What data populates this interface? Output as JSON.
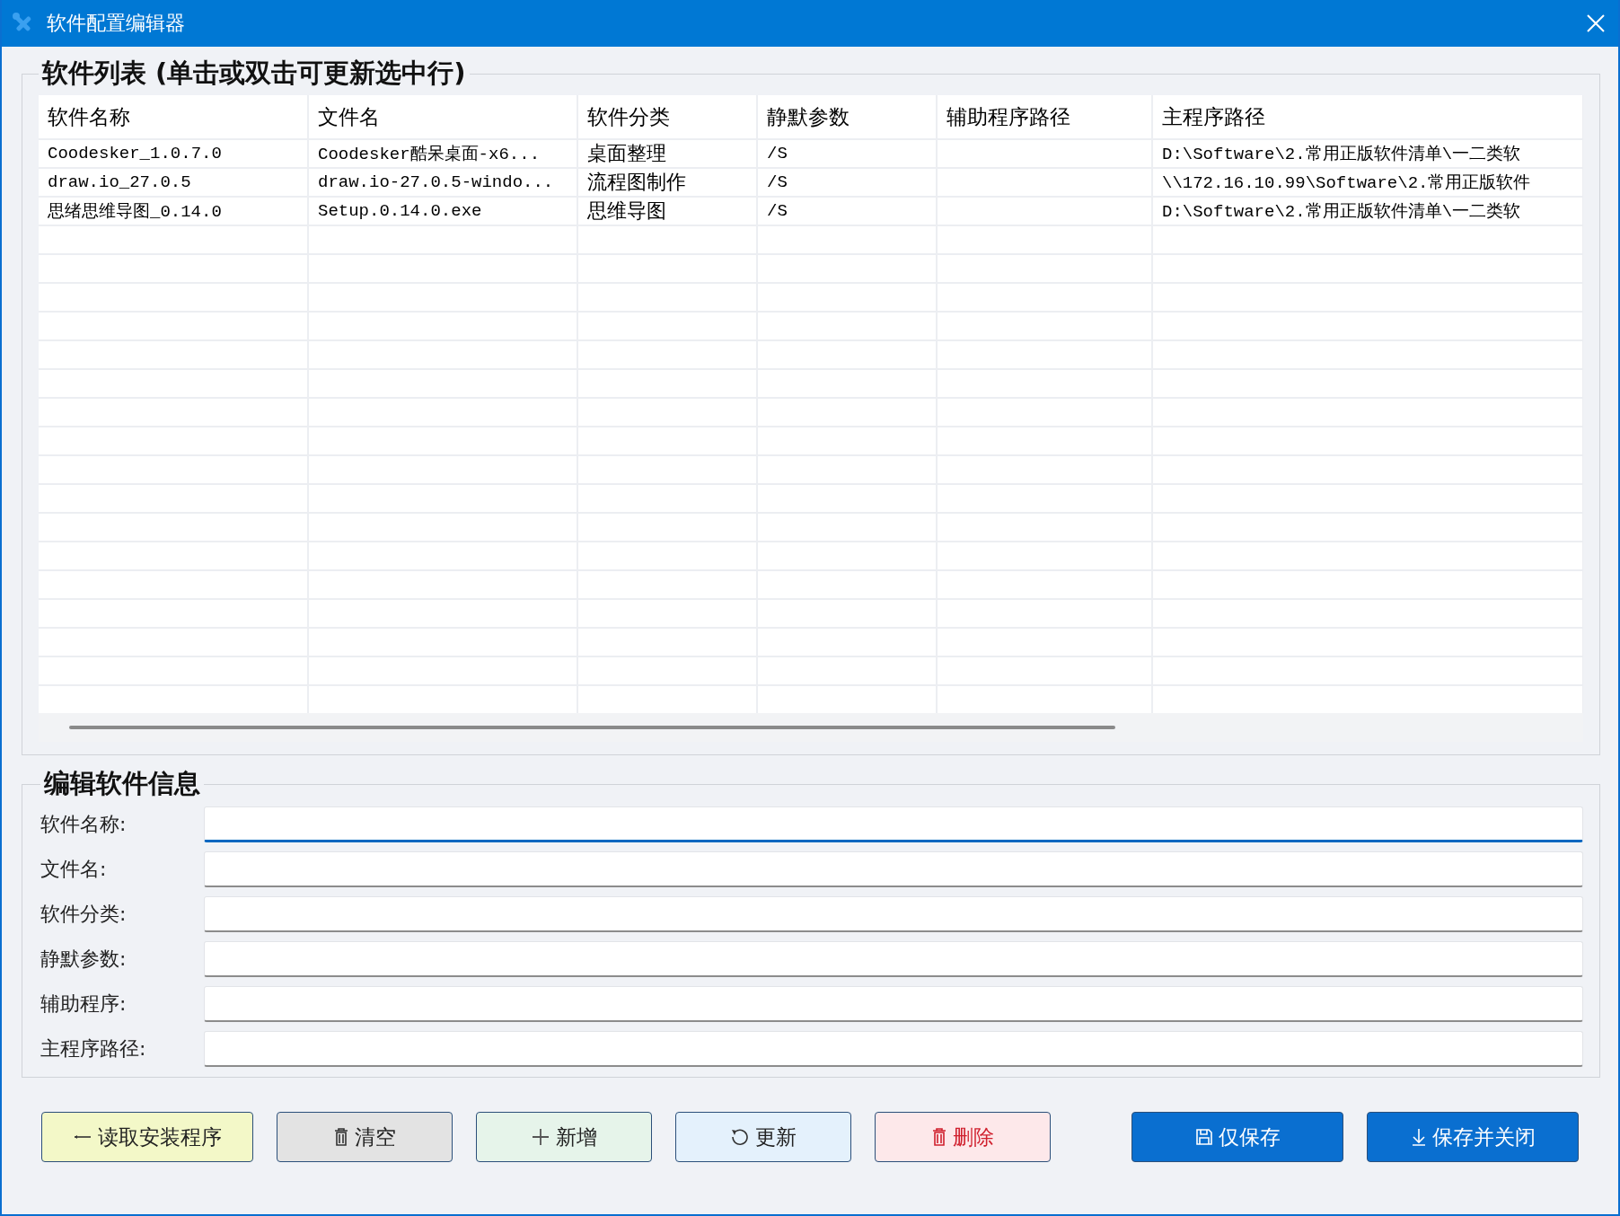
{
  "window": {
    "title": "软件配置编辑器"
  },
  "list": {
    "title": "软件列表 (单击或双击可更新选中行)",
    "columns": [
      "软件名称",
      "文件名",
      "软件分类",
      "静默参数",
      "辅助程序路径",
      "主程序路径"
    ],
    "rows": [
      [
        "Coodesker_1.0.7.0",
        "Coodesker酷呆桌面-x6...",
        "桌面整理",
        "/S",
        "",
        "D:\\Software\\2.常用正版软件清单\\一二类软"
      ],
      [
        "draw.io_27.0.5",
        "draw.io-27.0.5-windo...",
        "流程图制作",
        "/S",
        "",
        "\\\\172.16.10.99\\Software\\2.常用正版软件"
      ],
      [
        "思绪思维导图_0.14.0",
        "Setup.0.14.0.exe",
        "思维导图",
        "/S",
        "",
        "D:\\Software\\2.常用正版软件清单\\一二类软"
      ]
    ]
  },
  "edit": {
    "title": "编辑软件信息",
    "fields": [
      {
        "label": "软件名称:",
        "focused": true
      },
      {
        "label": "文件名:",
        "focused": false
      },
      {
        "label": "软件分类:",
        "focused": false
      },
      {
        "label": "静默参数:",
        "focused": false
      },
      {
        "label": "辅助程序:",
        "focused": false
      },
      {
        "label": "主程序路径:",
        "focused": false
      }
    ]
  },
  "buttons": [
    {
      "kind": "read",
      "label": "读取安装程序"
    },
    {
      "kind": "clear",
      "label": "清空"
    },
    {
      "kind": "add",
      "label": "新增"
    },
    {
      "kind": "update",
      "label": "更新"
    },
    {
      "kind": "delete",
      "label": "删除"
    },
    {
      "kind": "save",
      "label": "仅保存"
    },
    {
      "kind": "save_close",
      "label": "保存并关闭"
    }
  ]
}
